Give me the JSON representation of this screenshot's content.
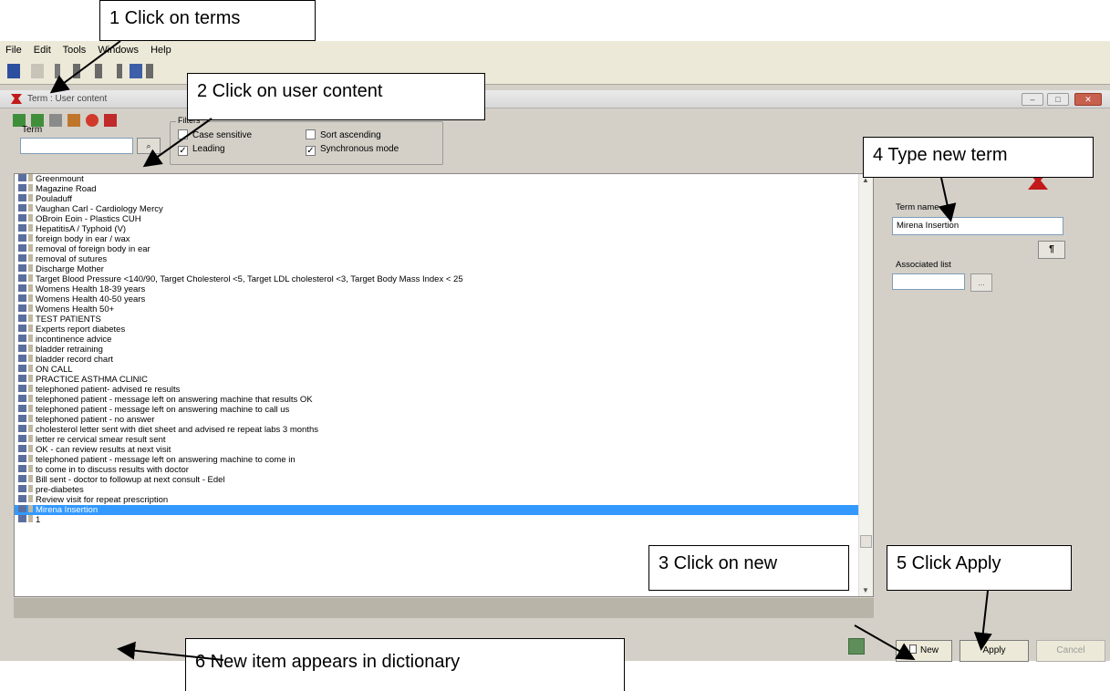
{
  "menu": [
    "File",
    "Edit",
    "Tools",
    "Windows",
    "Help"
  ],
  "window": {
    "title": "Term : User content",
    "min_glyph": "–",
    "max_glyph": "□",
    "close_glyph": "✕"
  },
  "search": {
    "term_label": "Term",
    "term_value": "",
    "search_button_glyph": "⌕"
  },
  "filters": {
    "legend": "Filters",
    "case_sensitive": {
      "label": "Case sensitive",
      "checked": false
    },
    "sort_ascending": {
      "label": "Sort ascending",
      "checked": false
    },
    "leading": {
      "label": "Leading",
      "checked": true
    },
    "synchronous_mode": {
      "label": "Synchronous mode",
      "checked": true
    }
  },
  "list_items": [
    "Greenmount",
    "Magazine Road",
    "Pouladuff",
    "Vaughan Carl - Cardiology Mercy",
    "OBroin Eoin - Plastics CUH",
    "HepatitisA / Typhoid (V)",
    "foreign body in ear / wax",
    "removal of foreign body in ear",
    "removal of sutures",
    "Discharge Mother",
    "Target Blood Pressure <140/90, Target Cholesterol <5, Target LDL cholesterol <3, Target Body Mass Index < 25",
    "Womens Health 18-39 years",
    "Womens Health 40-50 years",
    "Womens Health 50+",
    "TEST PATIENTS",
    "Experts report diabetes",
    "incontinence advice",
    "bladder retraining",
    "bladder record chart",
    "ON CALL",
    "PRACTICE ASTHMA CLINIC",
    "telephoned patient- advised re results",
    "telephoned patient - message left on answering machine that results OK",
    "telephoned patient - message left on answering machine to call us",
    "telephoned patient - no answer",
    "cholesterol letter sent with diet sheet and advised re repeat labs 3 months",
    "letter re cervical smear result sent",
    "OK - can review results at next visit",
    "telephoned patient - message left on answering machine to come in",
    "to come in to discuss results with doctor",
    "Bill sent - doctor to followup at next consult - Edel",
    "pre-diabetes",
    "Review visit for repeat prescription",
    "Mirena Insertion",
    "1"
  ],
  "selected_index": 33,
  "right_panel": {
    "term_name_label": "Term name",
    "term_name_value": "Mirena Insertion",
    "para_button": "¶",
    "associated_list_label": "Associated list",
    "associated_list_value": "",
    "associated_list_button": "..."
  },
  "buttons": {
    "new": "New",
    "apply": "Apply",
    "cancel": "Cancel"
  },
  "callouts": {
    "c1": "1 Click on terms",
    "c2": "2 Click on user content",
    "c3": "3 Click on new",
    "c4": "4 Type new term",
    "c5": "5 Click Apply",
    "c6": "6 New item appears in dictionary"
  },
  "colors": {
    "selection": "#3399ff",
    "logo_red": "#c21a1a"
  }
}
